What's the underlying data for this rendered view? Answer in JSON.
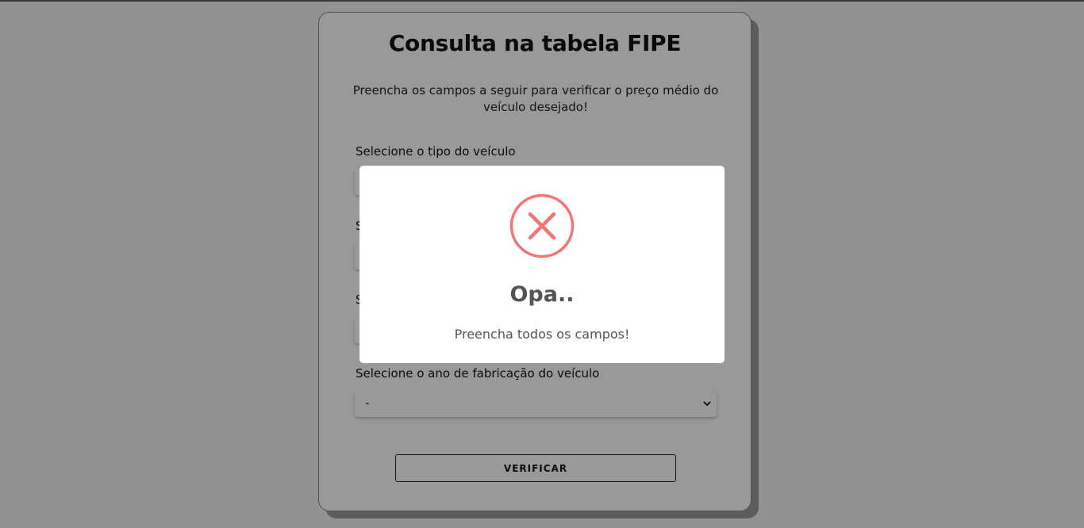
{
  "form": {
    "title": "Consulta na tabela FIPE",
    "subtitle": "Preencha os campos a seguir para verificar o preço médio do veículo desejado!",
    "fields": [
      {
        "label": "Selecione o tipo do veículo",
        "value": ""
      },
      {
        "label": "S",
        "value": ""
      },
      {
        "label": "S",
        "value": ""
      },
      {
        "label": "Selecione o ano de fabricação do veículo",
        "value": "-"
      }
    ],
    "verify_label": "VERIFICAR"
  },
  "modal": {
    "icon": "error-x-icon",
    "title": "Opa..",
    "message": "Preencha todos os campos!",
    "icon_color": "#f27474"
  },
  "colors": {
    "overlay": "rgba(0,0,0,0.4)",
    "card_bg": "#ffffff"
  }
}
